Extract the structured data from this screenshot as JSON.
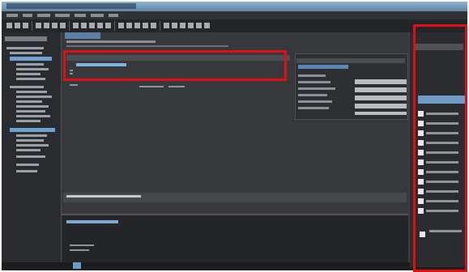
{
  "screenshot": {
    "note_text_legibility": "",
    "highlight_color": "#e01010"
  },
  "window": {
    "title": "",
    "theme": "dark"
  },
  "highlights": [
    {
      "id": "highlight-table",
      "color": "#e01010"
    },
    {
      "id": "highlight-right-panel",
      "color": "#e01010"
    }
  ],
  "right_panel": {
    "selected_index": 0,
    "items_count_shown": 12
  }
}
